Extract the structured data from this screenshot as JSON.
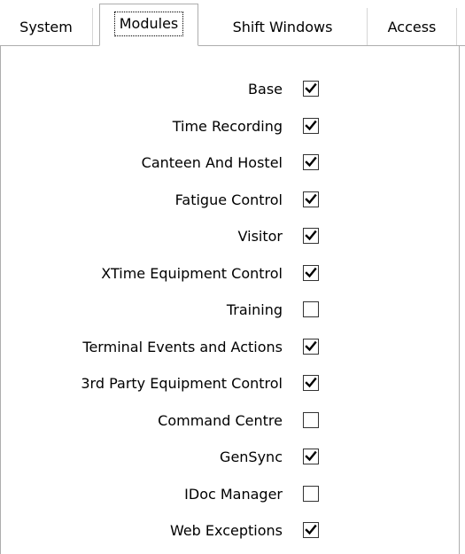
{
  "tabs": [
    {
      "label": "System",
      "selected": false
    },
    {
      "label": "Modules",
      "selected": true
    },
    {
      "label": "Shift Windows",
      "selected": false
    },
    {
      "label": "Access",
      "selected": false
    }
  ],
  "modules": [
    {
      "label": "Base",
      "checked": true
    },
    {
      "label": "Time Recording",
      "checked": true
    },
    {
      "label": "Canteen And Hostel",
      "checked": true
    },
    {
      "label": "Fatigue Control",
      "checked": true
    },
    {
      "label": "Visitor",
      "checked": true
    },
    {
      "label": "XTime Equipment Control",
      "checked": true
    },
    {
      "label": "Training",
      "checked": false
    },
    {
      "label": "Terminal Events and Actions",
      "checked": true
    },
    {
      "label": "3rd Party Equipment Control",
      "checked": true
    },
    {
      "label": "Command Centre",
      "checked": false
    },
    {
      "label": "GenSync",
      "checked": true
    },
    {
      "label": "IDoc Manager",
      "checked": false
    },
    {
      "label": "Web Exceptions",
      "checked": true
    }
  ]
}
